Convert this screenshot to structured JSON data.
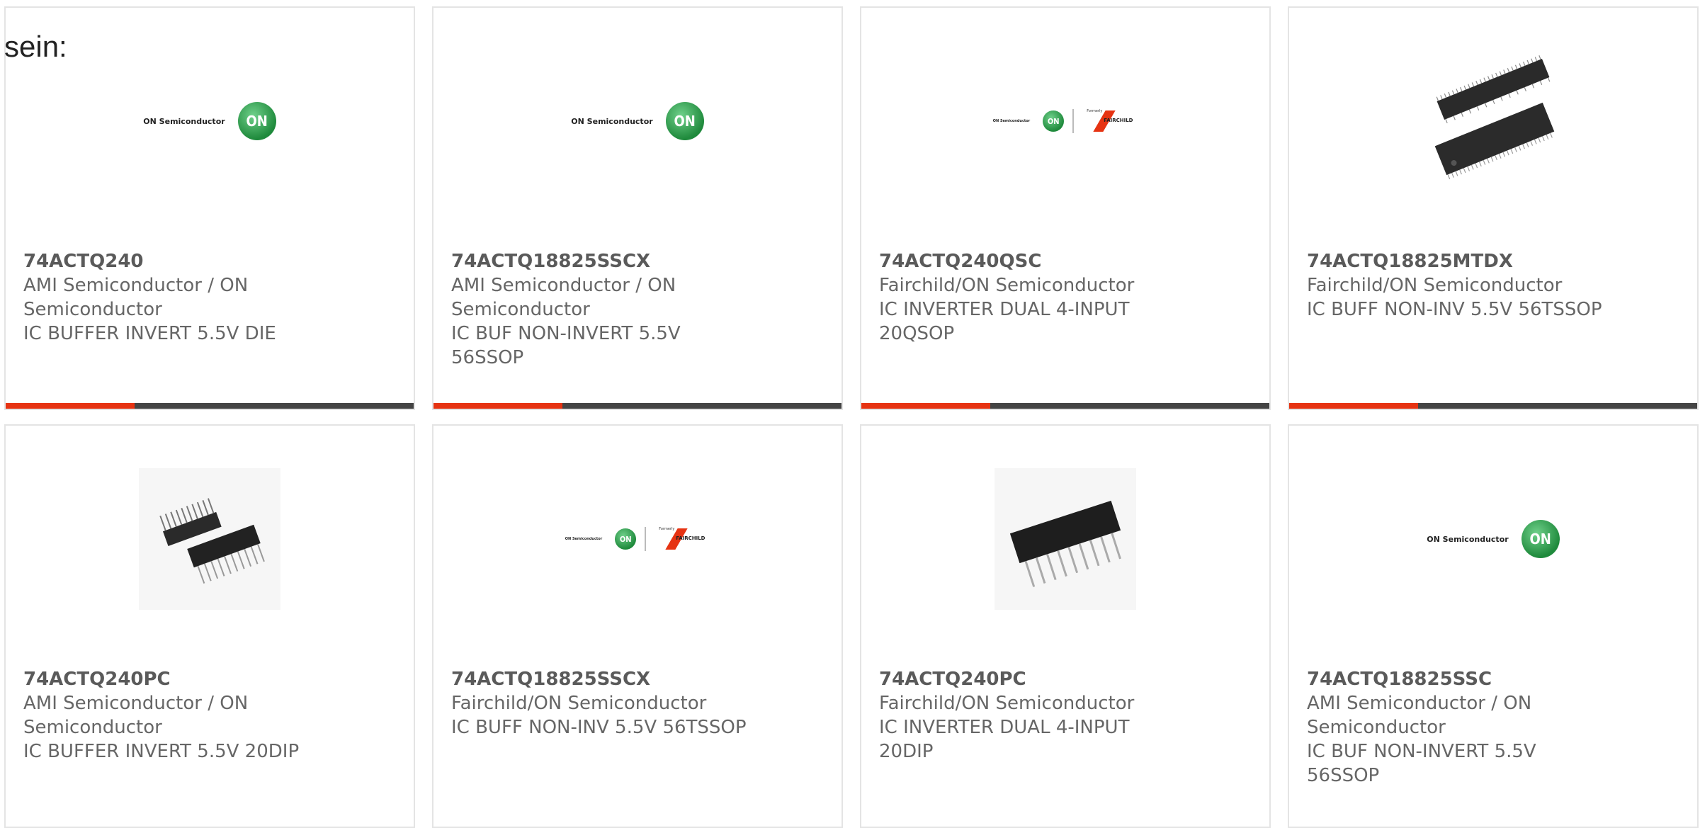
{
  "lead_text": "sein:",
  "brand_colors": {
    "accent": "#e63312",
    "bar": "#444444",
    "on_green": "#1f8a3c"
  },
  "logo_text": {
    "on_semi": "ON Semiconductor",
    "on_badge": "ON",
    "formerly": "Formerly",
    "fairchild": "FAIRCHILD"
  },
  "products": [
    {
      "part": "74ACTQ240",
      "manufacturer": "AMI Semiconductor / ON Semiconductor",
      "description": "IC BUFFER INVERT 5.5V DIE",
      "image": "on-semiconductor-logo"
    },
    {
      "part": "74ACTQ18825SSCX",
      "manufacturer": "AMI Semiconductor / ON Semiconductor",
      "description": "IC BUF NON-INVERT 5.5V 56SSOP",
      "image": "on-semiconductor-logo"
    },
    {
      "part": "74ACTQ240QSC",
      "manufacturer": "Fairchild/ON Semiconductor",
      "description": "IC INVERTER DUAL 4-INPUT 20QSOP",
      "image": "on-fairchild-logo"
    },
    {
      "part": "74ACTQ18825MTDX",
      "manufacturer": "Fairchild/ON Semiconductor",
      "description": "IC BUFF NON-INV 5.5V 56TSSOP",
      "image": "tssop-chip-photo"
    },
    {
      "part": "74ACTQ240PC",
      "manufacturer": "AMI Semiconductor / ON Semiconductor",
      "description": "IC BUFFER INVERT 5.5V 20DIP",
      "image": "dip-chip-pair-photo"
    },
    {
      "part": "74ACTQ18825SSCX",
      "manufacturer": "Fairchild/ON Semiconductor",
      "description": "IC BUFF NON-INV 5.5V 56TSSOP",
      "image": "on-fairchild-logo"
    },
    {
      "part": "74ACTQ240PC",
      "manufacturer": "Fairchild/ON Semiconductor",
      "description": "IC INVERTER DUAL 4-INPUT 20DIP",
      "image": "dip-chip-photo"
    },
    {
      "part": "74ACTQ18825SSC",
      "manufacturer": "AMI Semiconductor / ON Semiconductor",
      "description": "IC BUF NON-INVERT 5.5V 56SSOP",
      "image": "on-semiconductor-logo"
    }
  ]
}
